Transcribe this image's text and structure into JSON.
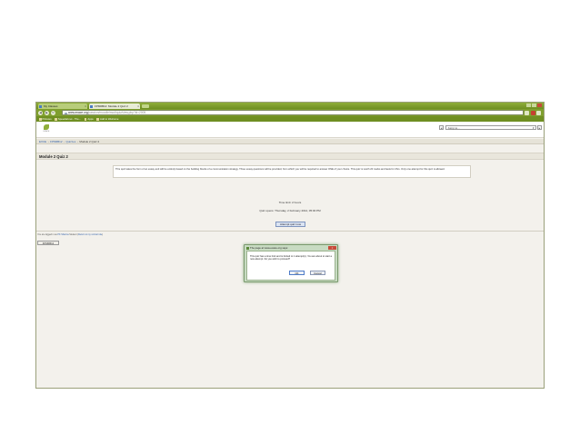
{
  "browser": {
    "tabs": [
      {
        "label": "My Classes"
      },
      {
        "label": "FPM0B12: Module 2 Quiz 2"
      }
    ],
    "url_host": "www.exace.org",
    "url_path": "/passion/moodle/mod/quiz/view.php?id=2005",
    "bookmarks": [
      "Pictures",
      "Speedial.net - The...",
      "Apps",
      "Add to Welcome"
    ]
  },
  "site": {
    "logo_text": "EXACE",
    "jump_to": "Jump to..."
  },
  "breadcrumb": [
    "EXCE",
    "FPM0B12",
    "Quizzes",
    "Module 2 Quiz 2"
  ],
  "quiz": {
    "title": "Module 2 Quiz 2",
    "intro": "This quiz takes the form of an essay and will be entirely based on the building blocks of a communication strategy. Three essay questions will be provided, from which you will be required to answer ONE of your choice. This quiz is worth 20 marks and lasts for 2hrs. Only one attempt for this quiz is allowed.",
    "time_limit": "Time limit: 2 hours",
    "opens": "Quiz opens: Thursday, 2 February 2012, 05:00 PM",
    "attempt_button": "Attempt quiz now"
  },
  "footer": {
    "logged_in_prefix": "You are logged in as",
    "logged_in_user": "PK Sharma",
    "logged_in_student": "Student",
    "return_link": "Return to my normal role",
    "course_button": "FPM0B12"
  },
  "dialog": {
    "title": "The page at www.exace.org says:",
    "message": "This quiz has a time limit and is limited to 1 attempt(s). You are about to start a new attempt. Do you wish to proceed?",
    "ok": "OK",
    "cancel": "Cancel"
  }
}
